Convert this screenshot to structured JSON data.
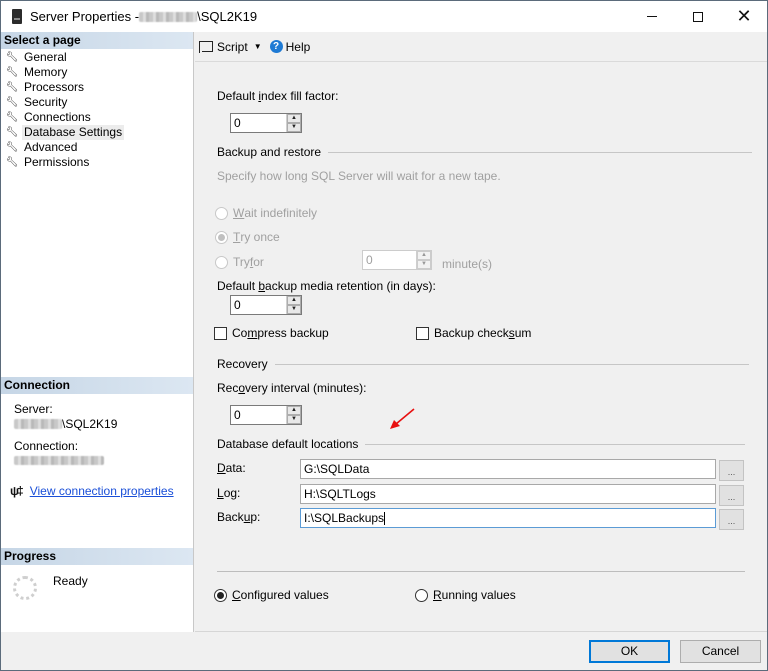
{
  "window": {
    "title_prefix": "Server Properties - ",
    "title_suffix": "\\SQL2K19",
    "controls": {
      "minimize": "minimize",
      "maximize": "maximize",
      "close": "✕"
    }
  },
  "sidebar": {
    "select_page_header": "Select a page",
    "pages": [
      {
        "label": "General",
        "icon": "wrench-icon"
      },
      {
        "label": "Memory",
        "icon": "wrench-icon"
      },
      {
        "label": "Processors",
        "icon": "wrench-icon"
      },
      {
        "label": "Security",
        "icon": "wrench-icon"
      },
      {
        "label": "Connections",
        "icon": "wrench-icon"
      },
      {
        "label": "Database Settings",
        "icon": "wrench-icon",
        "selected": true
      },
      {
        "label": "Advanced",
        "icon": "wrench-icon"
      },
      {
        "label": "Permissions",
        "icon": "wrench-icon"
      }
    ],
    "connection": {
      "header": "Connection",
      "server_label": "Server:",
      "server_value_suffix": "\\SQL2K19",
      "connection_label": "Connection:",
      "view_link": "View connection properties"
    },
    "progress": {
      "header": "Progress",
      "status": "Ready"
    }
  },
  "toolbar": {
    "script_label": "Script",
    "help_label": "Help"
  },
  "form": {
    "fill_factor": {
      "label_pre": "Default ",
      "label_u": "i",
      "label_post": "ndex fill factor:",
      "value": "0"
    },
    "backup_restore": {
      "title": "Backup and restore",
      "hint": "Specify how long SQL Server will wait for a new tape.",
      "wait_indefinitely": {
        "u": "W",
        "rest": "ait indefinitely",
        "selected": false
      },
      "try_once": {
        "u": "T",
        "rest": "ry once",
        "selected": true
      },
      "try_for": {
        "pre": "Try ",
        "u": "f",
        "rest": "or",
        "selected": false,
        "value": "0",
        "unit": "minute(s)"
      }
    },
    "retention": {
      "label_pre": "Default ",
      "label_u": "b",
      "label_post": "ackup media retention (in days):",
      "value": "0"
    },
    "compress_backup": {
      "pre": "Co",
      "u": "m",
      "post": "press backup",
      "checked": false
    },
    "backup_checksum": {
      "pre": "Backup check",
      "u": "s",
      "post": "um",
      "checked": false
    },
    "recovery": {
      "title": "Recovery",
      "interval_pre": "Rec",
      "interval_u": "o",
      "interval_post": "very interval (minutes):",
      "value": "0"
    },
    "locations": {
      "title": "Database default locations",
      "data": {
        "u": "D",
        "rest": "ata:",
        "value": "G:\\SQLData"
      },
      "log": {
        "u": "L",
        "rest": "og:",
        "value": "H:\\SQLTLogs"
      },
      "backup": {
        "pre": "Back",
        "u": "u",
        "rest": "p:",
        "value": "I:\\SQLBackups"
      },
      "browse_label": "..."
    },
    "values_mode": {
      "configured": {
        "u": "C",
        "rest": "onfigured values",
        "selected": true
      },
      "running": {
        "u": "R",
        "rest": "unning values",
        "selected": false
      }
    }
  },
  "footer": {
    "ok_label": "OK",
    "cancel_label": "Cancel"
  },
  "colors": {
    "accent": "#0078d7",
    "link": "#1a4fd8",
    "section_header": "#c6d6e6",
    "annotation_arrow": "#e81010"
  }
}
